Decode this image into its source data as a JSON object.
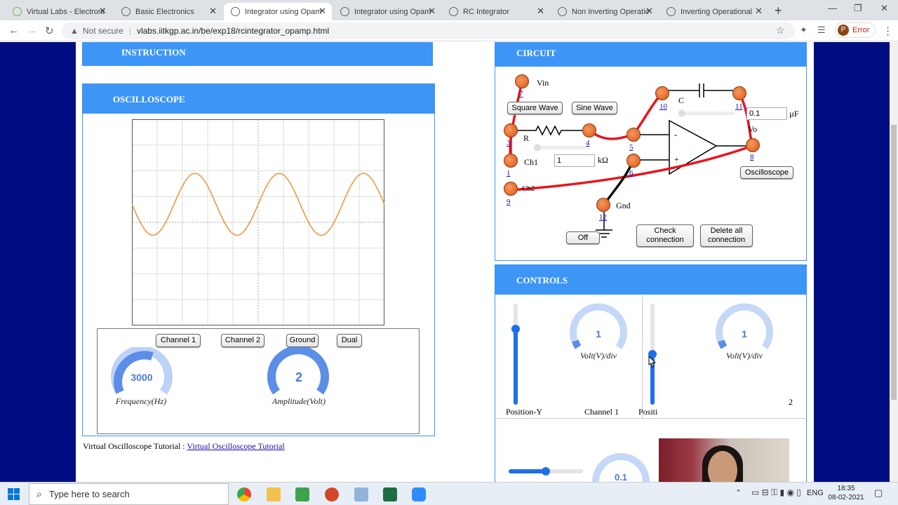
{
  "browser": {
    "tabs": [
      {
        "title": "Virtual Labs - Electronic",
        "active": false
      },
      {
        "title": "Basic Electronics",
        "active": false
      },
      {
        "title": "Integrator using Opam",
        "active": true
      },
      {
        "title": "Integrator using Opam",
        "active": false
      },
      {
        "title": "RC Integrator",
        "active": false
      },
      {
        "title": "Non Inverting Operatic",
        "active": false
      },
      {
        "title": "Inverting Operational",
        "active": false
      }
    ],
    "security": "Not secure",
    "url": "vlabs.iitkgp.ac.in/be/exp18/rcintegrator_opamp.html",
    "profile_initial": "P",
    "profile_status": "Error"
  },
  "instruction": {
    "title": "INSTRUCTION"
  },
  "oscilloscope": {
    "title": "OSCILLOSCOPE",
    "waveform": {
      "type": "sine",
      "color": "#f0913a",
      "cycles_visible": 3,
      "amplitude_divisions": 1.2,
      "offset_divisions": 0.7
    },
    "buttons": {
      "channel1": "Channel 1",
      "channel2": "Channel 2",
      "ground": "Ground",
      "dual": "Dual"
    },
    "frequency": {
      "value": "3000",
      "label": "Frequency(Hz)"
    },
    "amplitude": {
      "value": "2",
      "label": "Amplitude(Volt)"
    },
    "tutorial_prefix": "Virtual Oscilloscope Tutorial :",
    "tutorial_link": "Virtual Oscilloscope Tutorial"
  },
  "circuit": {
    "title": "CIRCUIT",
    "labels": {
      "vin": "Vin",
      "c": "C",
      "r": "R",
      "ch1": "Ch1",
      "ch2": "Ch2",
      "gnd": "Gnd",
      "vo": "Vo",
      "minus": "-",
      "plus": "+"
    },
    "nodes": {
      "n7": "7",
      "n10": "10",
      "n11": "11",
      "n3": "3",
      "n4": "4",
      "n5": "5",
      "n8": "8",
      "n1": "1",
      "n6": "6",
      "n9": "9",
      "n12": "12"
    },
    "square_wave": "Square Wave",
    "sine_wave": "Sine Wave",
    "capacitance_value": "0.1",
    "capacitance_unit": "µF",
    "resistance_value": "1",
    "resistance_unit": "kΩ",
    "oscilloscope_button": "Oscilloscope",
    "off_button": "Off",
    "check_button": "Check connection",
    "delete_button": "Delete all connection",
    "wire_color": "#e8141e"
  },
  "controls": {
    "title": "CONTROLS",
    "ch1_volt_div": {
      "value": "1",
      "label": "Volt(V)/div"
    },
    "ch2_volt_div": {
      "value": "1",
      "label": "Volt(V)/div"
    },
    "position_y_label": "Position-Y",
    "channel1_label": "Channel 1",
    "position_label_2": "Positi",
    "channel2_fragment": "2",
    "partial_knob_value": "0.1",
    "slider_levels": {
      "ch1_position": 0.75,
      "ch2_position": 0.5,
      "horizontal": 0.5
    }
  },
  "taskbar": {
    "search_placeholder": "Type here to search",
    "language": "ENG",
    "time": "18:35",
    "date": "08-02-2021"
  }
}
